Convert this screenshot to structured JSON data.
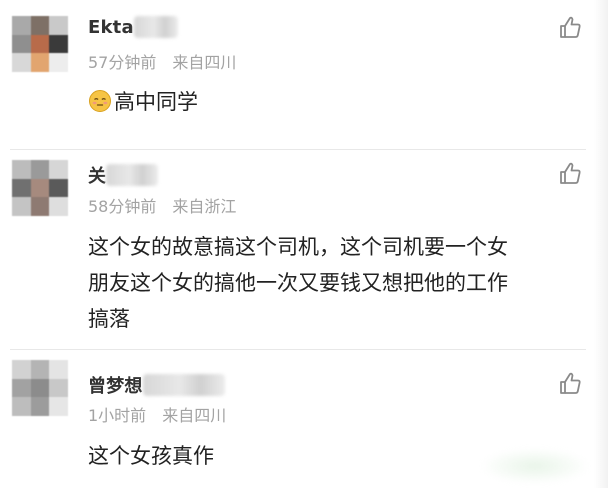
{
  "comments": [
    {
      "author": "Ekta",
      "time": "57分钟前",
      "location": "来自四川",
      "emoji": "blushing-face-emoji",
      "lines": [
        "高中同学"
      ]
    },
    {
      "author": "关",
      "time": "58分钟前",
      "location": "来自浙江",
      "lines": [
        "这个女的故意搞这个司机，这个司机要一个女",
        "朋友这个女的搞他一次又要钱又想把他的工作",
        "搞落"
      ]
    },
    {
      "author": "曾梦想",
      "time": "1小时前",
      "location": "来自四川",
      "lines": [
        "这个女孩真作"
      ]
    }
  ],
  "icons": {
    "like": "thumbs-up-icon"
  },
  "colors": {
    "name": "#333333",
    "meta": "#a3a3a3",
    "text": "#222222",
    "icon": "#8a8a8a"
  }
}
